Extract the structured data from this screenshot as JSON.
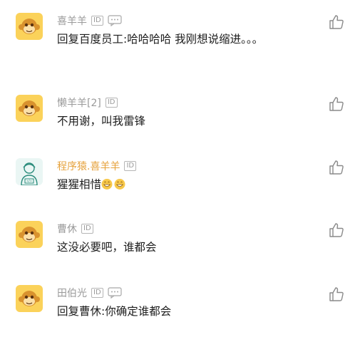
{
  "comments": [
    {
      "user": "喜羊羊",
      "text": "回复百度员工:哈哈哈哈  我刚想说缩进。。。",
      "has_msg_icon": true
    },
    {
      "user": "懒羊羊[2]",
      "text": "不用谢，叫我雷锋",
      "has_msg_icon": false
    },
    {
      "user": "程序猿.喜羊羊",
      "text": "猩猩相惜",
      "has_msg_icon": false
    },
    {
      "user": "曹休",
      "text": "这没必要吧，谁都会",
      "has_msg_icon": false
    },
    {
      "user": "田伯光",
      "text": "回复曹休:你确定谁都会",
      "has_msg_icon": true
    }
  ],
  "id_badge": "ID",
  "icons": {
    "avatar": "monkey-avatar-icon",
    "alt_avatar": "programmer-avatar-icon",
    "like": "thumbs-up-icon",
    "message": "message-icon",
    "emoji": "grinning-emoji-icon"
  },
  "colors": {
    "username": "#9a9a9a",
    "username_highlight": "#e6a23c",
    "text": "#1e1e1e",
    "avatar_bg": "#fbd25a",
    "alt_avatar_bg": "#eaf6f4"
  }
}
